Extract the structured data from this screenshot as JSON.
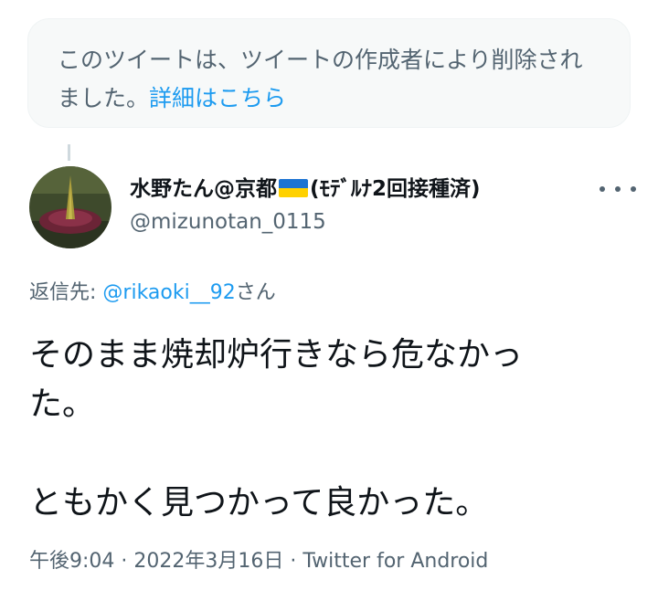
{
  "deleted_notice": {
    "line1": "このツイートは、ツイートの作成者により削除され",
    "line2_prefix": "ました。",
    "learn_more": "詳細はこちら"
  },
  "author": {
    "display_name_part1": "水野たん@京都",
    "display_name_part2": "(ﾓﾃﾞﾙﾅ2回接種済)",
    "handle": "@mizunotan_0115"
  },
  "reply": {
    "label": "返信先:",
    "mention": "@rikaoki__92",
    "suffix": "さん"
  },
  "tweet": {
    "line1": "そのまま焼却炉行きなら危なかっ",
    "line2": "た。",
    "line3": "ともかく見つかって良かった。"
  },
  "meta": {
    "time": "午後9:04",
    "sep1": " · ",
    "date": "2022年3月16日",
    "sep2": " · ",
    "source": "Twitter for Android"
  },
  "colors": {
    "accent": "#1d9bf0",
    "secondary_text": "#536471",
    "flag_blue": "#1d74d2",
    "flag_yellow": "#ffd100"
  },
  "icons": {
    "flag": "ukraine-flag-icon",
    "more": "more-horizontal-icon"
  }
}
